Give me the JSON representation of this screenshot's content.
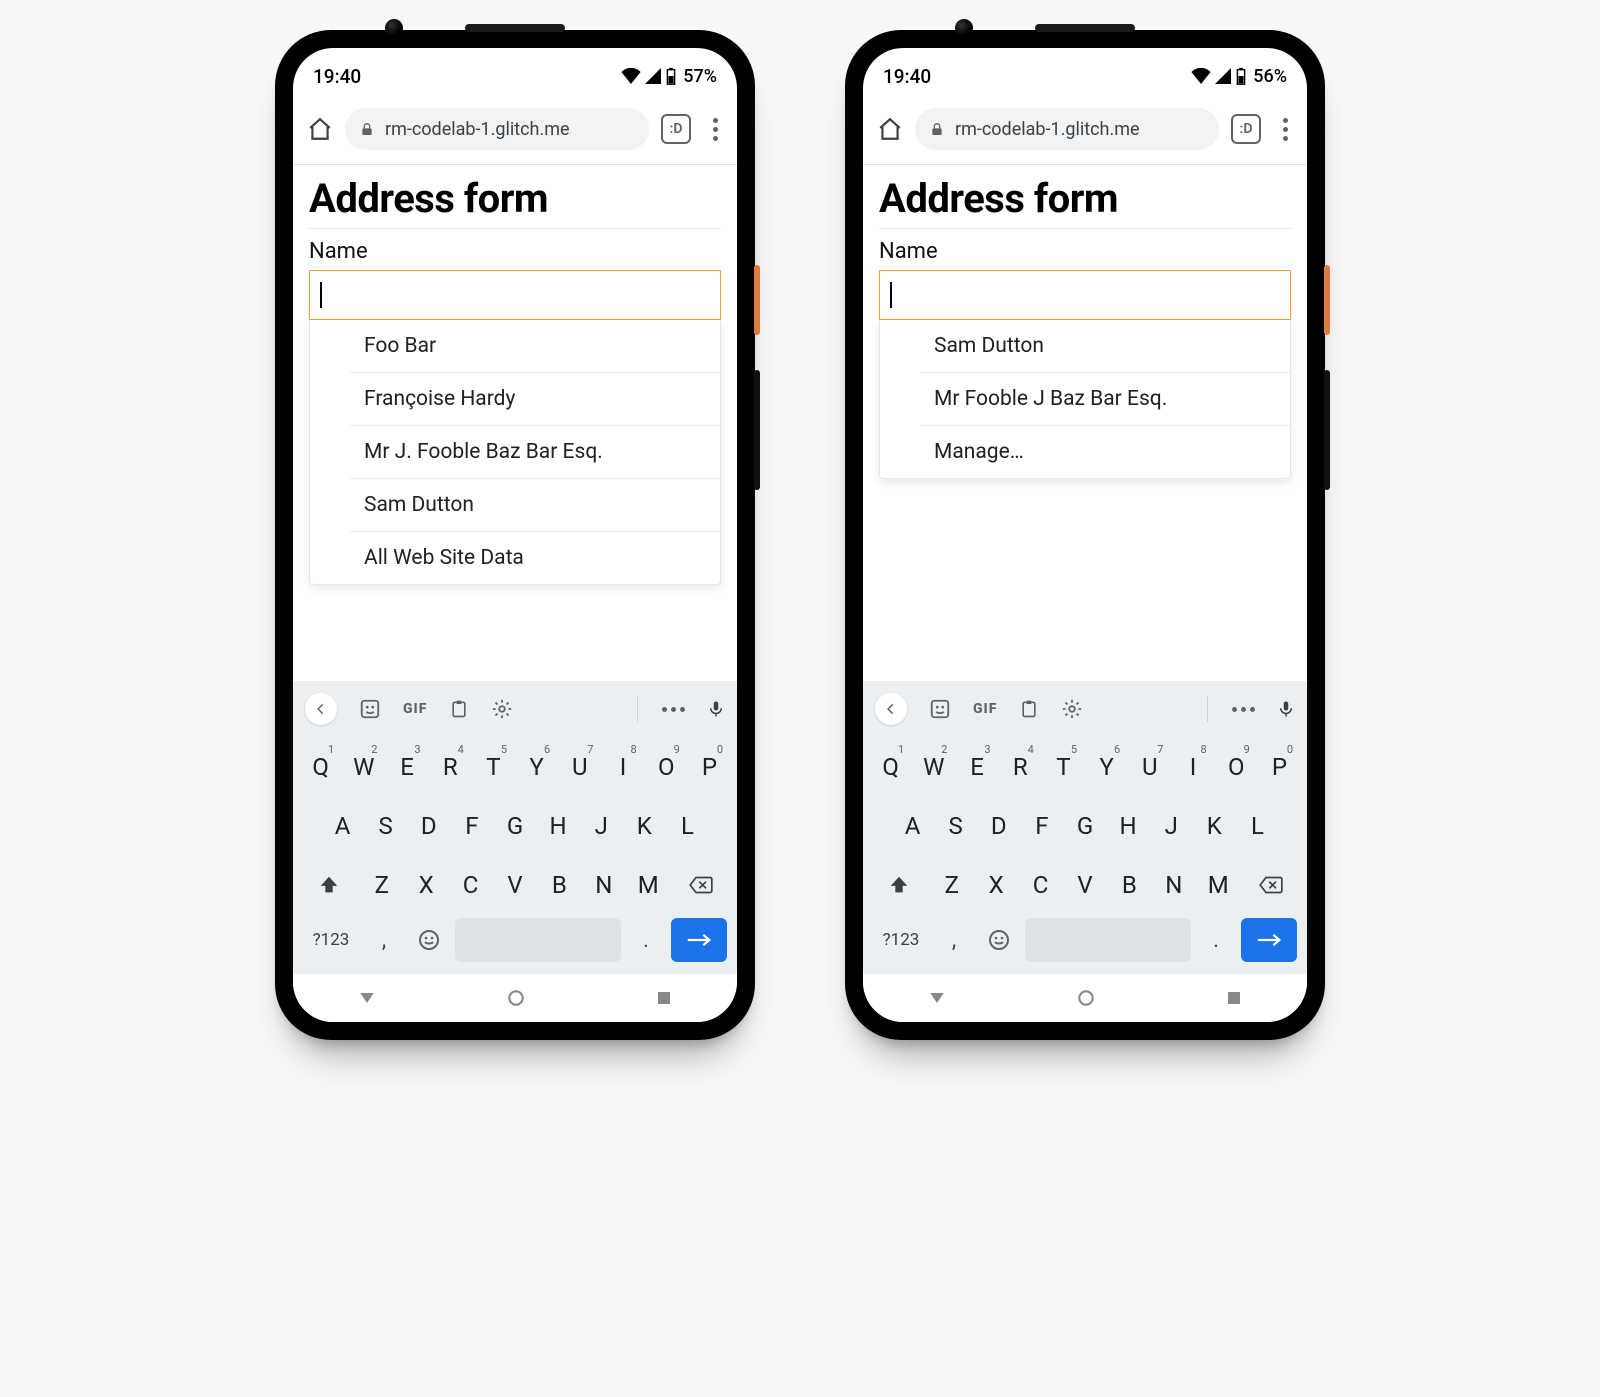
{
  "status": {
    "time": "19:40"
  },
  "chrome": {
    "url": "rm-codelab-1.glitch.me",
    "tab_count": ":D"
  },
  "page": {
    "title": "Address form",
    "name_label": "Name",
    "name_value": ""
  },
  "phones": [
    {
      "battery": "57%",
      "suggestions": [
        "Foo Bar",
        "Françoise Hardy",
        "Mr J. Fooble Baz Bar Esq.",
        "Sam Dutton",
        "All Web Site Data"
      ]
    },
    {
      "battery": "56%",
      "suggestions": [
        "Sam Dutton",
        "Mr Fooble J Baz Bar Esq.",
        "Manage…"
      ]
    }
  ],
  "keyboard": {
    "toolbar_gif": "GIF",
    "row1_letters": [
      "Q",
      "W",
      "E",
      "R",
      "T",
      "Y",
      "U",
      "I",
      "O",
      "P"
    ],
    "row1_nums": [
      "1",
      "2",
      "3",
      "4",
      "5",
      "6",
      "7",
      "8",
      "9",
      "0"
    ],
    "row2": [
      "A",
      "S",
      "D",
      "F",
      "G",
      "H",
      "J",
      "K",
      "L"
    ],
    "row3": [
      "Z",
      "X",
      "C",
      "V",
      "B",
      "N",
      "M"
    ],
    "abc": "?123",
    "comma": ",",
    "period": "."
  }
}
